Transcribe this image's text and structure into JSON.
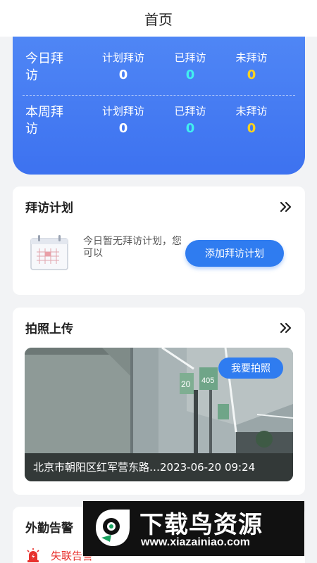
{
  "header": {
    "title": "首页"
  },
  "stats": {
    "today": {
      "label": "今日拜访",
      "planned_label": "计划拜访",
      "planned": "0",
      "visited_label": "已拜访",
      "visited": "0",
      "unvisited_label": "未拜访",
      "unvisited": "0"
    },
    "week": {
      "label": "本周拜访",
      "planned_label": "计划拜访",
      "planned": "0",
      "visited_label": "已拜访",
      "visited": "0",
      "unvisited_label": "未拜访",
      "unvisited": "0"
    }
  },
  "visit_plan": {
    "title": "拜访计划",
    "more_icon": "double-chevron-right-icon",
    "empty_text": "今日暂无拜访计划，您可以",
    "add_button": "添加拜访计划"
  },
  "photo_upload": {
    "title": "拍照上传",
    "more_icon": "double-chevron-right-icon",
    "take_photo_button": "我要拍照",
    "caption": "北京市朝阳区红军营东路…2023-06-20 09:24",
    "sign_number_1": "20",
    "sign_number_2": "405"
  },
  "field_alerts": {
    "title": "外勤告警",
    "items": [
      {
        "icon": "alarm-icon",
        "label": "失联告警"
      }
    ]
  },
  "watermark": {
    "brand": "下载鸟资源",
    "url": "www.xiazainiao.com"
  },
  "colors": {
    "primary": "#3d72f0",
    "cyan_value": "#41f0ef",
    "yellow_value": "#ffd21f",
    "alert_red": "#e8322e"
  }
}
